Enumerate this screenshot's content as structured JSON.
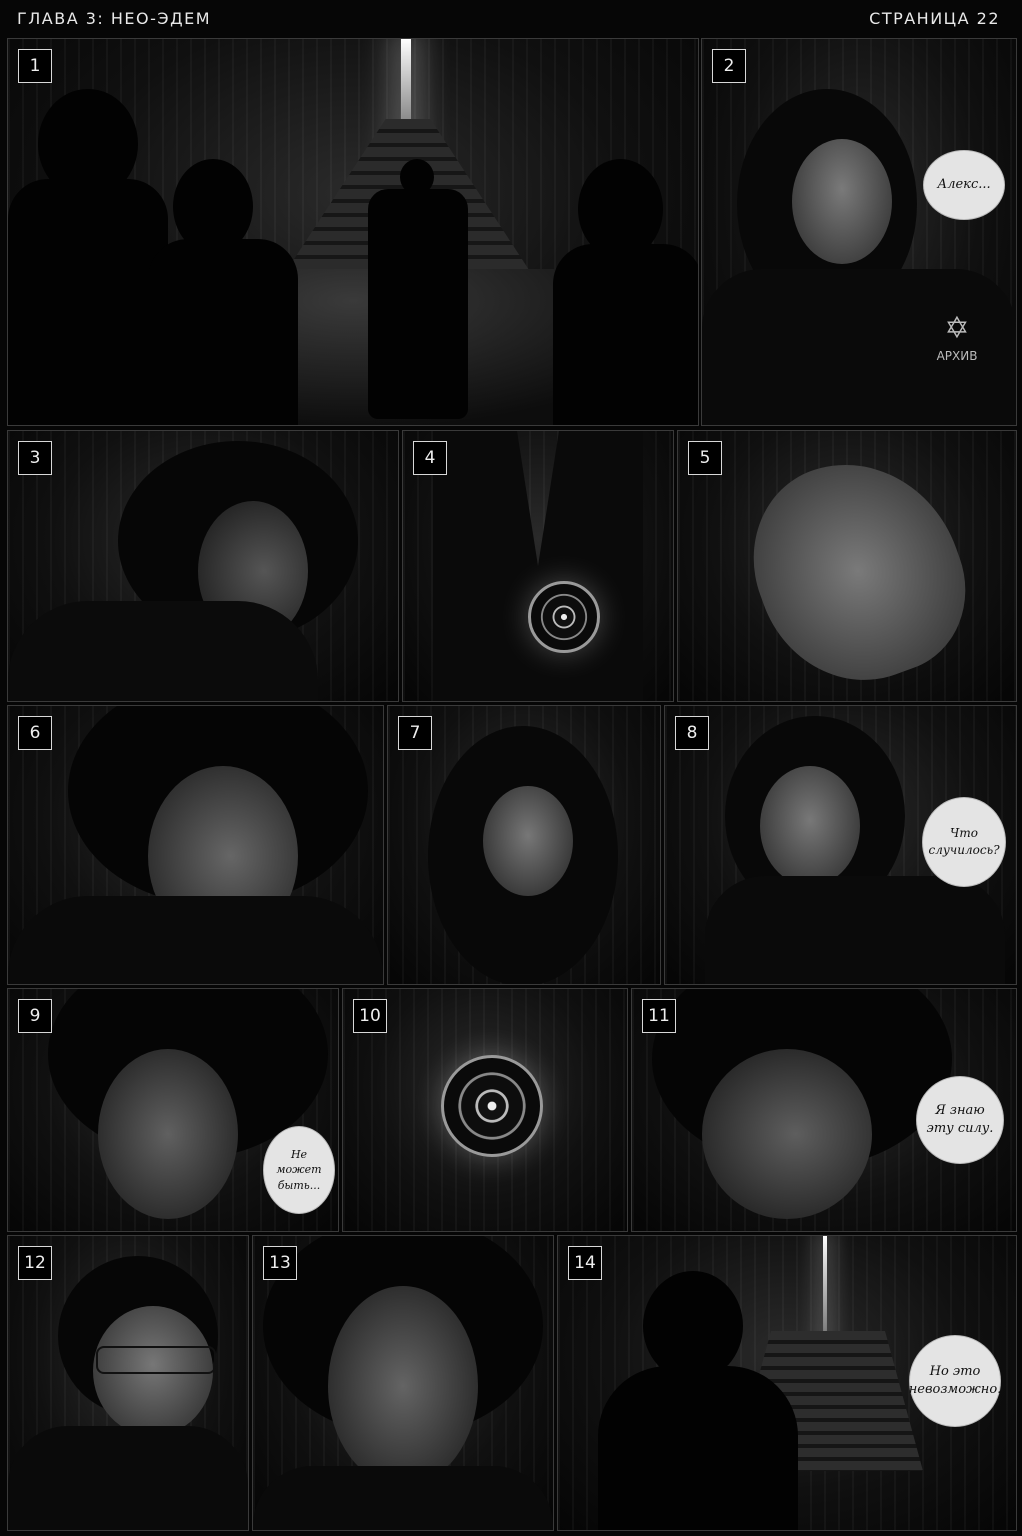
{
  "header": {
    "chapter": "ГЛАВА  3:  НЕО-ЭДЕМ",
    "page": "СТРАНИЦА  22"
  },
  "panels": [
    {
      "number": "1"
    },
    {
      "number": "2",
      "bubble": "Алекс...",
      "patch_text": "АРХИВ"
    },
    {
      "number": "3"
    },
    {
      "number": "4"
    },
    {
      "number": "5"
    },
    {
      "number": "6"
    },
    {
      "number": "7"
    },
    {
      "number": "8",
      "bubble": "Что случилось?"
    },
    {
      "number": "9",
      "bubble": "Не может быть..."
    },
    {
      "number": "10"
    },
    {
      "number": "11",
      "bubble": "Я знаю эту силу."
    },
    {
      "number": "12"
    },
    {
      "number": "13"
    },
    {
      "number": "14",
      "bubble": "Но это невозможно."
    }
  ]
}
